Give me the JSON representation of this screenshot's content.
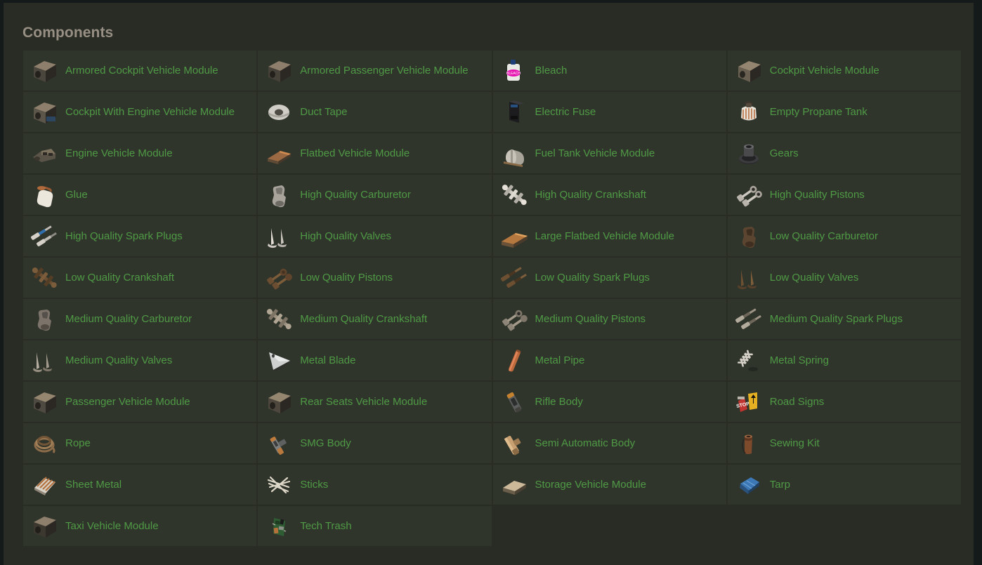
{
  "page": {
    "title": "Components",
    "accent_link_color": "#4f9a45",
    "title_color": "#988f84",
    "panel_background": "#282c25",
    "cell_background": "#30352c",
    "page_background": "#141a1a"
  },
  "grid": {
    "columns": 4,
    "rows": 13,
    "total_items": 50,
    "items": [
      {
        "label": "Armored Cockpit Vehicle Module",
        "icon": "armored-cockpit-vehicle-module-icon"
      },
      {
        "label": "Armored Passenger Vehicle Module",
        "icon": "armored-passenger-vehicle-module-icon"
      },
      {
        "label": "Bleach",
        "icon": "bleach-icon"
      },
      {
        "label": "Cockpit Vehicle Module",
        "icon": "cockpit-vehicle-module-icon"
      },
      {
        "label": "Cockpit With Engine Vehicle Module",
        "icon": "cockpit-with-engine-vehicle-module-icon"
      },
      {
        "label": "Duct Tape",
        "icon": "duct-tape-icon"
      },
      {
        "label": "Electric Fuse",
        "icon": "electric-fuse-icon"
      },
      {
        "label": "Empty Propane Tank",
        "icon": "empty-propane-tank-icon"
      },
      {
        "label": "Engine Vehicle Module",
        "icon": "engine-vehicle-module-icon"
      },
      {
        "label": "Flatbed Vehicle Module",
        "icon": "flatbed-vehicle-module-icon"
      },
      {
        "label": "Fuel Tank Vehicle Module",
        "icon": "fuel-tank-vehicle-module-icon"
      },
      {
        "label": "Gears",
        "icon": "gears-icon"
      },
      {
        "label": "Glue",
        "icon": "glue-icon"
      },
      {
        "label": "High Quality Carburetor",
        "icon": "high-quality-carburetor-icon"
      },
      {
        "label": "High Quality Crankshaft",
        "icon": "high-quality-crankshaft-icon"
      },
      {
        "label": "High Quality Pistons",
        "icon": "high-quality-pistons-icon"
      },
      {
        "label": "High Quality Spark Plugs",
        "icon": "high-quality-spark-plugs-icon"
      },
      {
        "label": "High Quality Valves",
        "icon": "high-quality-valves-icon"
      },
      {
        "label": "Large Flatbed Vehicle Module",
        "icon": "large-flatbed-vehicle-module-icon"
      },
      {
        "label": "Low Quality Carburetor",
        "icon": "low-quality-carburetor-icon"
      },
      {
        "label": "Low Quality Crankshaft",
        "icon": "low-quality-crankshaft-icon"
      },
      {
        "label": "Low Quality Pistons",
        "icon": "low-quality-pistons-icon"
      },
      {
        "label": "Low Quality Spark Plugs",
        "icon": "low-quality-spark-plugs-icon"
      },
      {
        "label": "Low Quality Valves",
        "icon": "low-quality-valves-icon"
      },
      {
        "label": "Medium Quality Carburetor",
        "icon": "medium-quality-carburetor-icon"
      },
      {
        "label": "Medium Quality Crankshaft",
        "icon": "medium-quality-crankshaft-icon"
      },
      {
        "label": "Medium Quality Pistons",
        "icon": "medium-quality-pistons-icon"
      },
      {
        "label": "Medium Quality Spark Plugs",
        "icon": "medium-quality-spark-plugs-icon"
      },
      {
        "label": "Medium Quality Valves",
        "icon": "medium-quality-valves-icon"
      },
      {
        "label": "Metal Blade",
        "icon": "metal-blade-icon"
      },
      {
        "label": "Metal Pipe",
        "icon": "metal-pipe-icon"
      },
      {
        "label": "Metal Spring",
        "icon": "metal-spring-icon"
      },
      {
        "label": "Passenger Vehicle Module",
        "icon": "passenger-vehicle-module-icon"
      },
      {
        "label": "Rear Seats Vehicle Module",
        "icon": "rear-seats-vehicle-module-icon"
      },
      {
        "label": "Rifle Body",
        "icon": "rifle-body-icon"
      },
      {
        "label": "Road Signs",
        "icon": "road-signs-icon"
      },
      {
        "label": "Rope",
        "icon": "rope-icon"
      },
      {
        "label": "SMG Body",
        "icon": "smg-body-icon"
      },
      {
        "label": "Semi Automatic Body",
        "icon": "semi-automatic-body-icon"
      },
      {
        "label": "Sewing Kit",
        "icon": "sewing-kit-icon"
      },
      {
        "label": "Sheet Metal",
        "icon": "sheet-metal-icon"
      },
      {
        "label": "Sticks",
        "icon": "sticks-icon"
      },
      {
        "label": "Storage Vehicle Module",
        "icon": "storage-vehicle-module-icon"
      },
      {
        "label": "Tarp",
        "icon": "tarp-icon"
      },
      {
        "label": "Taxi Vehicle Module",
        "icon": "taxi-vehicle-module-icon"
      },
      {
        "label": "Tech Trash",
        "icon": "tech-trash-icon"
      }
    ]
  }
}
